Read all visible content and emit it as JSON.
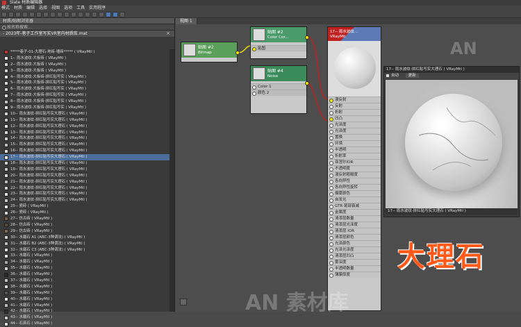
{
  "window": {
    "title": "Slate 材质编辑器"
  },
  "menu": [
    "模式",
    "材质",
    "编辑",
    "选择",
    "视图",
    "选项",
    "工具",
    "实用程序"
  ],
  "browser": {
    "title": "材质/贴图浏览器",
    "search_placeholder": "按名称搜索...",
    "library_header": "- 2023年-巷子工作室写实VR室内材质库.mat",
    "items": [
      {
        "label": "*****巷子-01-大理石-地砖-墙砖*****  ( VRayMtl )",
        "color": "#c23030"
      },
      {
        "label": "1-- 雨水波纹-大板砖   ( VRayMtl )",
        "color": "#e8e8e8"
      },
      {
        "label": "2-- 雨水波纹-大板砖   ( VRayMtl )",
        "color": "#d8d8d8"
      },
      {
        "label": "3-- 雨水波纹-大板砖   ( VRayMtl )",
        "color": "#cfcfcf"
      },
      {
        "label": "4-- 雨水波纹-大板砖-拼红贴写实   ( VRayMtl )",
        "color": "#e0e0e0"
      },
      {
        "label": "5-- 雨水波纹-大板砖-拼红贴写实   ( VRayMtl )",
        "color": "#d4d4d4"
      },
      {
        "label": "6-- 雨水波纹-大板砖-拼红贴写实   ( VRayMtl )",
        "color": "#c8c8c8"
      },
      {
        "label": "7-- 雨水波纹-大板砖-拼红贴写实   ( VRayMtl )",
        "color": "#dddddd"
      },
      {
        "label": "8-- 雨水波纹-大板砖-拼红贴写实   ( VRayMtl )",
        "color": "#bfbfbf"
      },
      {
        "label": "9-- 雨水波纹-大板砖-拼红贴写实   ( VRayMtl )",
        "color": "#e4e4e4"
      },
      {
        "label": "10-- 雨水波纹-拼红贴写实大理石   ( VRayMtl )",
        "color": "#d0d0d0"
      },
      {
        "label": "11-- 雨水波纹-拼红贴写实大理石   ( VRayMtl )",
        "color": "#c4c4c4"
      },
      {
        "label": "12-- 雨水波纹-拼红贴写实大理石   ( VRayMtl )",
        "color": "#e2e2e2"
      },
      {
        "label": "13-- 雨水波纹-拼红贴写实大理石   ( VRayMtl )",
        "color": "#d6d6d6"
      },
      {
        "label": "14-- 雨水波纹-拼红贴写实大理石   ( VRayMtl )",
        "color": "#cacaca"
      },
      {
        "label": "15-- 雨水波纹-拼红贴写实大理石   ( VRayMtl )",
        "color": "#bdbdbd"
      },
      {
        "label": "16-- 雨水波纹-拼红贴写实大理石   ( VRayMtl )",
        "color": "#dadada"
      },
      {
        "label": "17-- 雨水波纹-拼红贴写实大理石   ( VRayMtl )",
        "color": "#e8e8e8",
        "selected": true
      },
      {
        "label": "18-- 雨水波纹-拼红贴写实大理石   ( VRayMtl )",
        "color": "#cecece"
      },
      {
        "label": "19-- 雨水波纹-拼红贴写实大理石   ( VRayMtl )",
        "color": "#c2c2c2"
      },
      {
        "label": "20-- 雨水波纹-拼红贴写实大理石   ( VRayMtl )",
        "color": "#d9d9d9"
      },
      {
        "label": "21-- 雨水波纹-拼红贴写实大理石   ( VRayMtl )",
        "color": "#b8b8b8"
      },
      {
        "label": "22-- 雨水波纹-拼红贴写实大理石   ( VRayMtl )",
        "color": "#cccccc"
      },
      {
        "label": "23-- 雨水波纹-拼红贴写实大理石   ( VRayMtl )",
        "color": "#dedede"
      },
      {
        "label": "24-- 雨水波纹-拼红贴写实大理石   ( VRayMtl )",
        "color": "#c6c6c6"
      },
      {
        "label": "25-- 瓷砖   ( VRayMtl )",
        "color": "#e6e6e6"
      },
      {
        "label": "26-- 瓷砖   ( VRayMtl )",
        "color": "#d3d3d3"
      },
      {
        "label": "27-- 仿古砖   ( VRayMtl )",
        "color": "#6f5f4a"
      },
      {
        "label": "28-- 仿古砖   ( VRayMtl )",
        "color": "#5a4a3a"
      },
      {
        "label": "29-- 仿古砖   ( VRayMtl )",
        "color": "#7a6a58"
      },
      {
        "label": "30-- 水磨石 A1  (ABC-3种调法)   ( VRayMtl )",
        "color": "#cfcfcf"
      },
      {
        "label": "31-- 水磨石 B2  (ABC-3种调法)   ( VRayMtl )",
        "color": "#bcbcbc"
      },
      {
        "label": "32-- 水磨石 C3  (ABC-3种调法)   ( VRayMtl )",
        "color": "#d8d8d8"
      },
      {
        "label": "33-- 水磨石   ( VRayMtl )",
        "color": "#e0e0e0"
      },
      {
        "label": "34-- 水磨石   ( VRayMtl )",
        "color": "#a8a8a8"
      },
      {
        "label": "35-- 水磨石   ( VRayMtl )",
        "color": "#d2d2d2"
      },
      {
        "label": "36-- 水磨石   ( VRayMtl )",
        "color": "#2a2a2a"
      },
      {
        "label": "37-- 水磨石   ( VRayMtl )",
        "color": "#c0c0c0"
      },
      {
        "label": "38-- 水磨石   ( VRayMtl )",
        "color": "#d6d6d6"
      },
      {
        "label": "39-- 水磨石   ( VRayMtl )",
        "color": "#555555"
      },
      {
        "label": "40-- 水磨石   ( VRayMtl )",
        "color": "#e4e4e4"
      },
      {
        "label": "41-- 水磨石   ( VRayMtl )",
        "color": "#bababa"
      },
      {
        "label": "42-- 水磨石   ( VRayMtl )",
        "color": "#303030"
      },
      {
        "label": "43-- 水磨石   ( VRayMtl )",
        "color": "#cacaca"
      },
      {
        "label": "44-- 石英石   ( VRayMtl )",
        "color": "#dcdcdc"
      }
    ]
  },
  "view": {
    "tab": "视图 1",
    "nodes": {
      "bitmap": {
        "name": "贴图 #2",
        "type": "Bitmap",
        "color": "#5aa05a"
      },
      "color_correction": {
        "name": "贴图 #2",
        "type": "Color Cor...",
        "slot": "贴图",
        "color": "#4a9a6a"
      },
      "noise": {
        "name": "贴图 #4",
        "type": "Noise",
        "slots": [
          "Color 1",
          "颜色 2"
        ],
        "color": "#3a8a5a"
      },
      "material": {
        "name": "17-- 雨水波纹...",
        "type": "VRayMtl",
        "slots": [
          "漫反射",
          "反射",
          "折射",
          "凹凸",
          "光泽度",
          "光泽度",
          "置换",
          "环境",
          "半透明",
          "折射率",
          "菲涅尔IOR",
          "不透明度",
          "漫反射粗糙度",
          "各向异性",
          "各向异性旋转",
          "烟雾颜色",
          "自发光",
          "GTR 尾部衰减",
          "金属度",
          "清漆层数量",
          "清漆层光泽度",
          "清漆层 IOR",
          "清漆层颜色",
          "光泽颜色",
          "光泽光泽度",
          "清漆层凹凸",
          "雾深度",
          "半透明数量",
          "薄膜厚度"
        ],
        "connected": [
          0,
          3
        ]
      }
    }
  },
  "preview": {
    "title": "17-- 雨水波纹-拼红贴写实大理石 ( VRayMtl )",
    "auto_label": "自动",
    "update_label": "更新",
    "footer": "17-- 雨水波纹-拼红贴写实大理石 ( VRayMtl )"
  },
  "overlay": {
    "label": "大理石",
    "watermark_text": "AN 素材库",
    "watermark_short": "AN",
    "color": "#ff5a1a"
  }
}
